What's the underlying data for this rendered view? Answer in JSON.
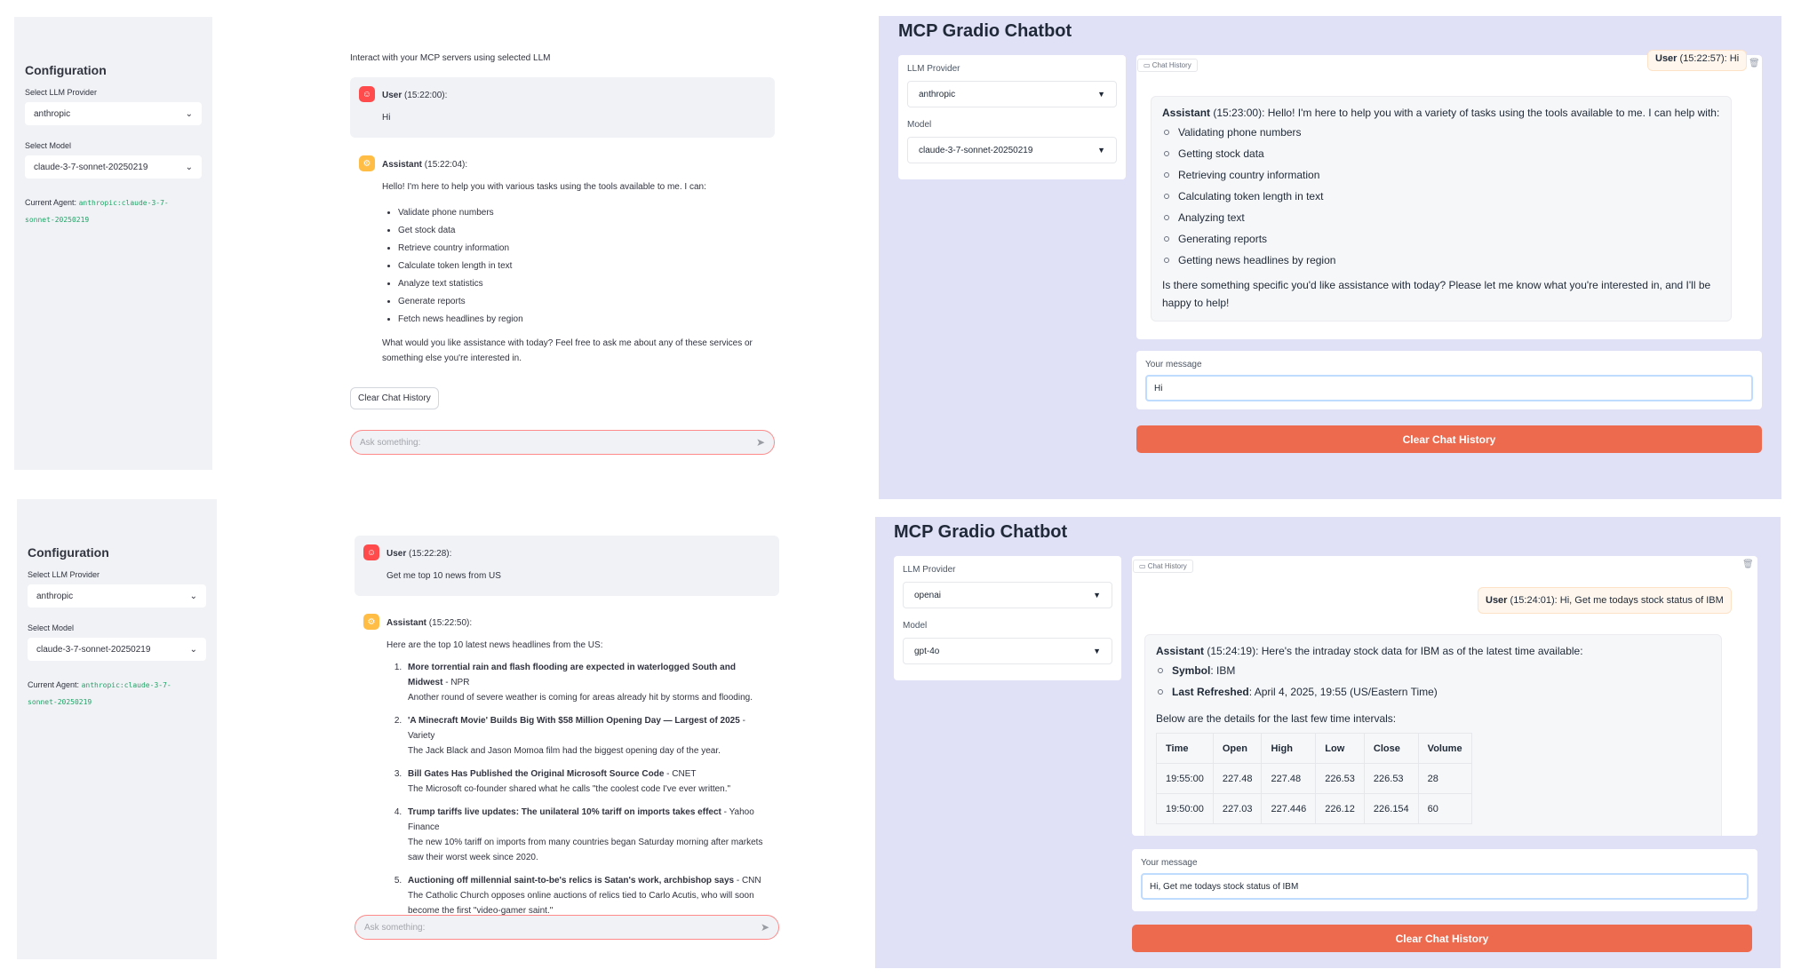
{
  "st_top": {
    "sidebar": {
      "title": "Configuration",
      "provider_label": "Select LLM Provider",
      "provider_value": "anthropic",
      "model_label": "Select Model",
      "model_value": "claude-3-7-sonnet-20250219",
      "agent_label": "Current Agent:",
      "agent_value": "anthropic:claude-3-7-sonnet-20250219"
    },
    "caption": "Interact with your MCP servers using selected LLM",
    "user_msg": {
      "role": "User",
      "time": "(15:22:00):",
      "text": "Hi"
    },
    "asst_msg": {
      "role": "Assistant",
      "time": "(15:22:04):",
      "intro": "Hello! I'm here to help you with various tasks using the tools available to me. I can:",
      "items": [
        "Validate phone numbers",
        "Get stock data",
        "Retrieve country information",
        "Calculate token length in text",
        "Analyze text statistics",
        "Generate reports",
        "Fetch news headlines by region"
      ],
      "outro": "What would you like assistance with today? Feel free to ask me about any of these services or something else you're interested in."
    },
    "clear_button": "Clear Chat History",
    "chat_placeholder": "Ask something:"
  },
  "st_bottom": {
    "sidebar": {
      "title": "Configuration",
      "provider_label": "Select LLM Provider",
      "provider_value": "anthropic",
      "model_label": "Select Model",
      "model_value": "claude-3-7-sonnet-20250219",
      "agent_label": "Current Agent:",
      "agent_value": "anthropic:claude-3-7-sonnet-20250219"
    },
    "user_msg": {
      "role": "User",
      "time": "(15:22:28):",
      "text": "Get me top 10 news from US"
    },
    "asst_msg": {
      "role": "Assistant",
      "time": "(15:22:50):",
      "intro": "Here are the top 10 latest news headlines from the US:",
      "news": [
        {
          "headline": "More torrential rain and flash flooding are expected in waterlogged South and Midwest",
          "source": " - NPR",
          "desc": "Another round of severe weather is coming for areas already hit by storms and flooding."
        },
        {
          "headline": "'A Minecraft Movie' Builds Big With $58 Million Opening Day — Largest of 2025",
          "source": " - Variety",
          "desc": "The Jack Black and Jason Momoa film had the biggest opening day of the year."
        },
        {
          "headline": "Bill Gates Has Published the Original Microsoft Source Code",
          "source": " - CNET",
          "desc": "The Microsoft co-founder shared what he calls \"the coolest code I've ever written.\""
        },
        {
          "headline": "Trump tariffs live updates: The unilateral 10% tariff on imports takes effect",
          "source": " - Yahoo Finance",
          "desc": "The new 10% tariff on imports from many countries began Saturday morning after markets saw their worst week since 2020."
        },
        {
          "headline": "Auctioning off millennial saint-to-be's relics is Satan's work, archbishop says",
          "source": " - CNN",
          "desc": "The Catholic Church opposes online auctions of relics tied to Carlo Acutis, who will soon become the first \"video-gamer saint.\""
        }
      ]
    },
    "chat_placeholder": "Ask something:"
  },
  "gr_top": {
    "title": "MCP Gradio Chatbot",
    "provider_label": "LLM Provider",
    "provider_value": "anthropic",
    "model_label": "Model",
    "model_value": "claude-3-7-sonnet-20250219",
    "chat_label": "Chat History",
    "user_msg": {
      "role": "User",
      "rest": " (15:22:57): Hi"
    },
    "asst_msg": {
      "role": "Assistant",
      "rest": " (15:23:00): Hello! I'm here to help you with a variety of tasks using the tools available to me. I can help with:",
      "items": [
        "Validating phone numbers",
        "Getting stock data",
        "Retrieving country information",
        "Calculating token length in text",
        "Analyzing text",
        "Generating reports",
        "Getting news headlines by region"
      ],
      "outro": "Is there something specific you'd like assistance with today? Please let me know what you're interested in, and I'll be happy to help!"
    },
    "message_label": "Your message",
    "message_value": "Hi",
    "clear_button": "Clear Chat History"
  },
  "gr_bottom": {
    "title": "MCP Gradio Chatbot",
    "provider_label": "LLM Provider",
    "provider_value": "openai",
    "model_label": "Model",
    "model_value": "gpt-4o",
    "chat_label": "Chat History",
    "user_msg": {
      "role": "User",
      "rest": " (15:24:01): Hi, Get me todays stock status of IBM"
    },
    "asst_msg": {
      "role": "Assistant",
      "rest": " (15:24:19): Here's the intraday stock data for IBM as of the latest time available:",
      "symbol_label": "Symbol",
      "symbol_value": ": IBM",
      "refreshed_label": "Last Refreshed",
      "refreshed_value": ": April 4, 2025, 19:55 (US/Eastern Time)",
      "table_intro": "Below are the details for the last few time intervals:",
      "columns": [
        "Time",
        "Open",
        "High",
        "Low",
        "Close",
        "Volume"
      ],
      "rows": [
        [
          "19:55:00",
          "227.48",
          "227.48",
          "226.53",
          "226.53",
          "28"
        ],
        [
          "19:50:00",
          "227.03",
          "227.446",
          "226.12",
          "226.154",
          "60"
        ]
      ]
    },
    "message_label": "Your message",
    "message_value": "Hi, Get me todays stock status of IBM",
    "clear_button": "Clear Chat History"
  }
}
